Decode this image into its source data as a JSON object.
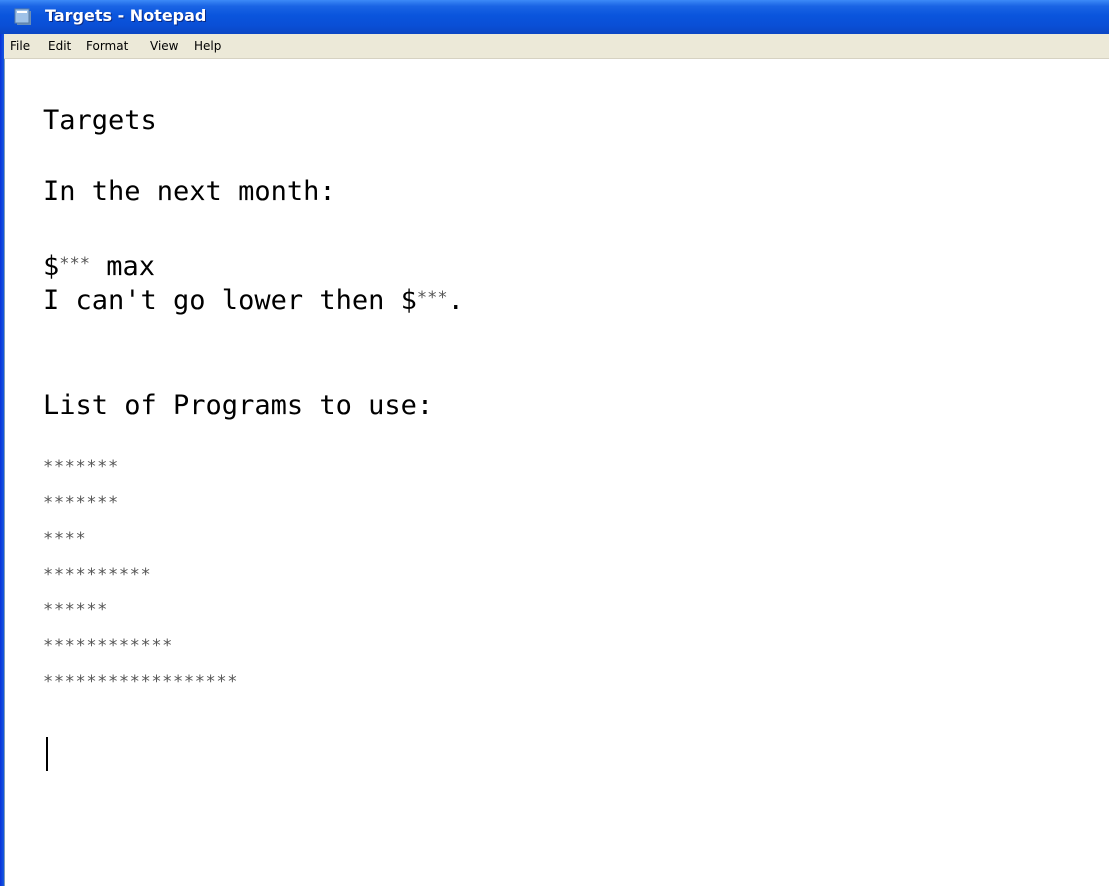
{
  "window": {
    "title": "Targets - Notepad",
    "icon": "notepad-icon"
  },
  "menu": [
    "File",
    "Edit",
    "Format",
    "View",
    "Help"
  ],
  "document": {
    "line_title": "Targets",
    "line_month": "In the next month:",
    "line_max_prefix": "$",
    "line_max_masked": "***",
    "line_max_suffix": " max",
    "line_lower_prefix": "I can't go lower then $",
    "line_lower_masked": "***",
    "line_lower_suffix": ".",
    "line_programs": "List of Programs to use:",
    "program_lines": [
      "*******",
      "*******",
      "****",
      "**********",
      "******",
      "************",
      "******************"
    ]
  },
  "colors": {
    "titlebar": "#0a55dd",
    "menubar": "#ece9d8",
    "text": "#000000",
    "masked_text": "#555555"
  }
}
